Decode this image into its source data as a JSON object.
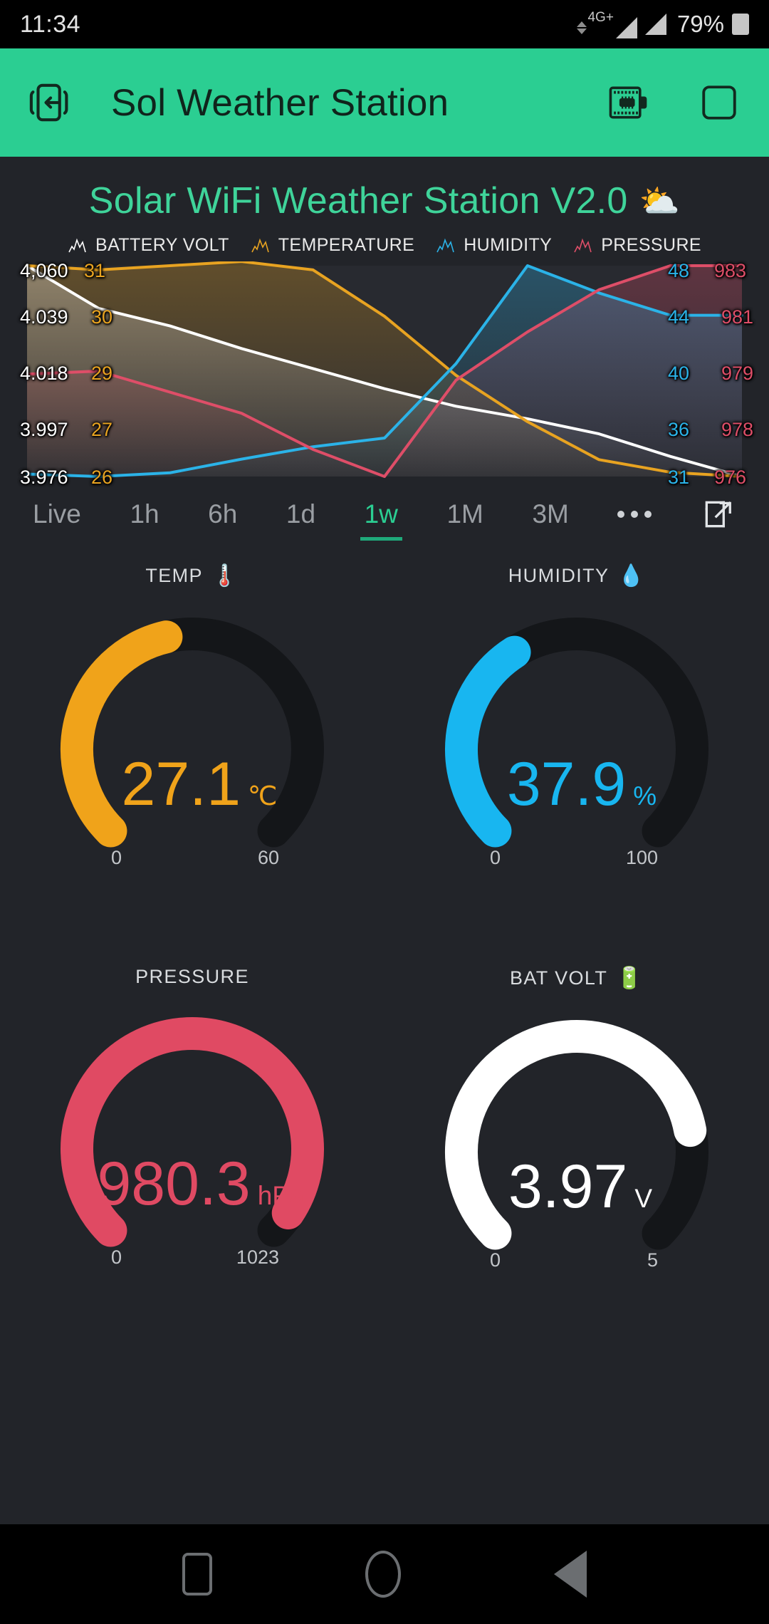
{
  "status_bar": {
    "time": "11:34",
    "network_generation": "4G+",
    "battery_percent": "79%",
    "icons": [
      "data-transfer-icon",
      "signal-bars-icon",
      "signal-bars-icon",
      "battery-icon"
    ]
  },
  "app_bar": {
    "title": "Sol Weather Station",
    "back_icon": "exit-device-icon",
    "device_icon": "microcontroller-board-icon",
    "square_icon": "square-outline-icon"
  },
  "chart": {
    "title": "Solar WiFi Weather Station V2.0",
    "title_emoji": "⛅",
    "legend": [
      {
        "label": "BATTERY VOLT",
        "color": "#FFFFFF",
        "icon": "sparkline-icon"
      },
      {
        "label": "TEMPERATURE",
        "color": "#E8A321",
        "icon": "sparkline-icon"
      },
      {
        "label": "HUMIDITY",
        "color": "#2BB3E8",
        "icon": "sparkline-icon"
      },
      {
        "label": "PRESSURE",
        "color": "#DE4E68",
        "icon": "sparkline-icon"
      }
    ],
    "left_axis_battery": [
      "4,060",
      "4.039",
      "4.018",
      "3.997",
      "3.976"
    ],
    "left_axis_temperature": [
      "31",
      "30",
      "29",
      "27",
      "26"
    ],
    "right_axis_humidity": [
      "48",
      "44",
      "40",
      "36",
      "31"
    ],
    "right_axis_pressure": [
      "983",
      "981",
      "979",
      "978",
      "976"
    ]
  },
  "chart_data": {
    "type": "line",
    "title": "Solar WiFi Weather Station V2.0",
    "xlabel": "",
    "ylabel": "",
    "grid": false,
    "legend_position": "top-center",
    "x": [
      0,
      1,
      2,
      3,
      4,
      5,
      6,
      7,
      8,
      9,
      10
    ],
    "series": [
      {
        "name": "BATTERY VOLT",
        "color": "#FFFFFF",
        "axis": "left",
        "unit": "V",
        "ylim": [
          3.976,
          4.06
        ],
        "ticks": [
          "4,060",
          "4.039",
          "4.018",
          "3.997",
          "3.976"
        ],
        "values": [
          4.06,
          4.043,
          4.036,
          4.027,
          4.019,
          4.011,
          4.004,
          3.999,
          3.993,
          3.984,
          3.976
        ]
      },
      {
        "name": "TEMPERATURE",
        "color": "#E8A321",
        "axis": "left",
        "unit": "°C",
        "ylim": [
          26,
          31
        ],
        "ticks": [
          "31",
          "30",
          "29",
          "27",
          "26"
        ],
        "values": [
          31.0,
          30.9,
          31.0,
          31.1,
          30.9,
          29.8,
          28.4,
          27.3,
          26.4,
          26.1,
          26.0
        ]
      },
      {
        "name": "HUMIDITY",
        "color": "#2BB3E8",
        "axis": "right",
        "unit": "%",
        "ylim": [
          31,
          48
        ],
        "ticks": [
          "48",
          "44",
          "40",
          "36",
          "31"
        ],
        "values": [
          31.2,
          31.0,
          31.3,
          32.4,
          33.4,
          34.1,
          40.1,
          48.0,
          45.8,
          44.0,
          44.0
        ]
      },
      {
        "name": "PRESSURE",
        "color": "#DE4E68",
        "axis": "right",
        "unit": "hPa",
        "ylim": [
          976,
          983
        ],
        "ticks": [
          "983",
          "981",
          "979",
          "978",
          "976"
        ],
        "values": [
          979.4,
          979.5,
          978.8,
          978.1,
          976.9,
          976.0,
          979.2,
          980.8,
          982.2,
          983.0,
          983.0
        ]
      }
    ]
  },
  "ranges": {
    "options": [
      "Live",
      "1h",
      "6h",
      "1d",
      "1w",
      "1M",
      "3M"
    ],
    "active": "1w",
    "more_icon": "more-dots-icon",
    "expand_icon": "expand-external-icon"
  },
  "gauges": [
    {
      "id": "temp",
      "label": "TEMP",
      "emoji": "🌡️",
      "value": "27.1",
      "unit": "℃",
      "min": "0",
      "max": "60",
      "min_num": 0,
      "max_num": 60,
      "value_num": 27.1,
      "color": "#F0A31A"
    },
    {
      "id": "humidity",
      "label": "HUMIDITY",
      "emoji": "💧",
      "value": "37.9",
      "unit": "%",
      "min": "0",
      "max": "100",
      "min_num": 0,
      "max_num": 100,
      "value_num": 37.9,
      "color": "#18B6F0"
    },
    {
      "id": "pressure",
      "label": "PRESSURE",
      "emoji": "",
      "value": "980.3",
      "unit": "hPa",
      "min": "0",
      "max": "1023",
      "min_num": 0,
      "max_num": 1023,
      "value_num": 980.3,
      "color": "#E04A63"
    },
    {
      "id": "batvolt",
      "label": "BAT VOLT",
      "emoji": "🔋",
      "value": "3.97",
      "unit": "V",
      "min": "0",
      "max": "5",
      "min_num": 0,
      "max_num": 5,
      "value_num": 3.97,
      "color": "#FFFFFF"
    }
  ],
  "nav_bar": {
    "recents_icon": "recents-square-icon",
    "home_icon": "home-circle-icon",
    "back_icon": "back-triangle-icon"
  },
  "theme": {
    "accent": "#2BCE92",
    "background": "#222429",
    "track": "#1B1D21"
  }
}
